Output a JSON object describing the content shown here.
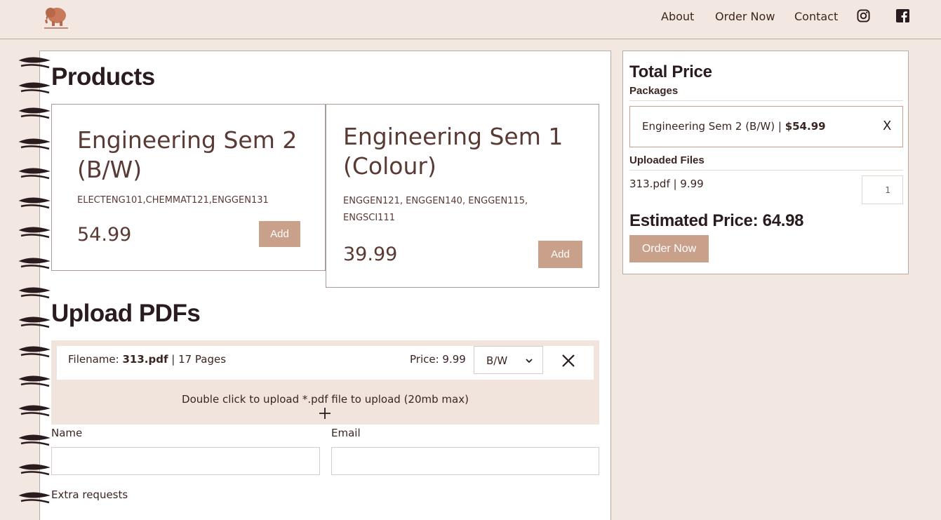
{
  "nav": {
    "links": [
      "About",
      "Order Now",
      "Contact"
    ],
    "icons": [
      "instagram-icon",
      "facebook-icon"
    ]
  },
  "colors": {
    "background": "#f3e8e1",
    "accent": "#c9a08a",
    "text": "#3b2521"
  },
  "products": {
    "title": "Products",
    "items": [
      {
        "name": "Engineering Sem 2 (B/W)",
        "codes": "ELECTENG101,CHEMMAT121,ENGGEN131",
        "price": "54.99",
        "button": "Add"
      },
      {
        "name": "Engineering Sem 1 (Colour)",
        "codes": "ENGGEN121, ENGGEN140, ENGGEN115, ENGSCI111",
        "price": "39.99",
        "button": "Add"
      }
    ]
  },
  "upload": {
    "title": "Upload PDFs",
    "file": {
      "filename_label": "Filename: ",
      "filename": "313.pdf",
      "pages": " | 17 Pages",
      "price": "Price: 9.99",
      "mode": "B/W"
    },
    "instructions": "Double click to upload *.pdf file to upload (20mb max)"
  },
  "form": {
    "name_label": "Name",
    "email_label": "Email",
    "extra_label": "Extra requests"
  },
  "summary": {
    "title": "Total Price",
    "packages_label": "Packages",
    "package_item": "Engineering Sem 2 (B/W) | ",
    "package_price": "$54.99",
    "remove": "X",
    "files_label": "Uploaded Files",
    "file_line": "313.pdf | 9.99",
    "quantity": "1",
    "estimated": "Estimated Price: 64.98",
    "order_button": "Order Now"
  }
}
